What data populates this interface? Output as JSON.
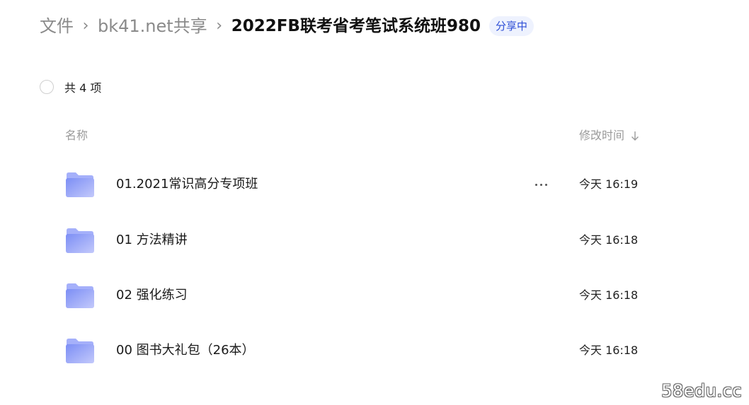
{
  "breadcrumb": {
    "items": [
      {
        "label": "文件"
      },
      {
        "label": "bk41.net共享"
      }
    ],
    "separator": "›",
    "current": "2022FB联考省考笔试系统班980",
    "share_badge": "分享中"
  },
  "list": {
    "count_label": "共 4 项",
    "columns": {
      "name": "名称",
      "time": "修改时间"
    },
    "sort": {
      "column": "time",
      "icon": "arrow-down-icon"
    },
    "rows": [
      {
        "name": "01.2021常识高分专项班",
        "time": "今天 16:19",
        "icon": "folder-icon",
        "more": true
      },
      {
        "name": "01 方法精讲",
        "time": "今天 16:18",
        "icon": "folder-icon",
        "more": false
      },
      {
        "name": "02 强化练习",
        "time": "今天 16:18",
        "icon": "folder-icon",
        "more": false
      },
      {
        "name": "00 图书大礼包（26本）",
        "time": "今天 16:18",
        "icon": "folder-icon",
        "more": false
      }
    ]
  },
  "watermark": "58edu.cc",
  "colors": {
    "accent": "#2e4fd6",
    "badge_bg": "#eef2fe",
    "folder_front": "#7c8ef5",
    "folder_back": "#a5b0fa",
    "muted_text": "#8a8a8a"
  }
}
